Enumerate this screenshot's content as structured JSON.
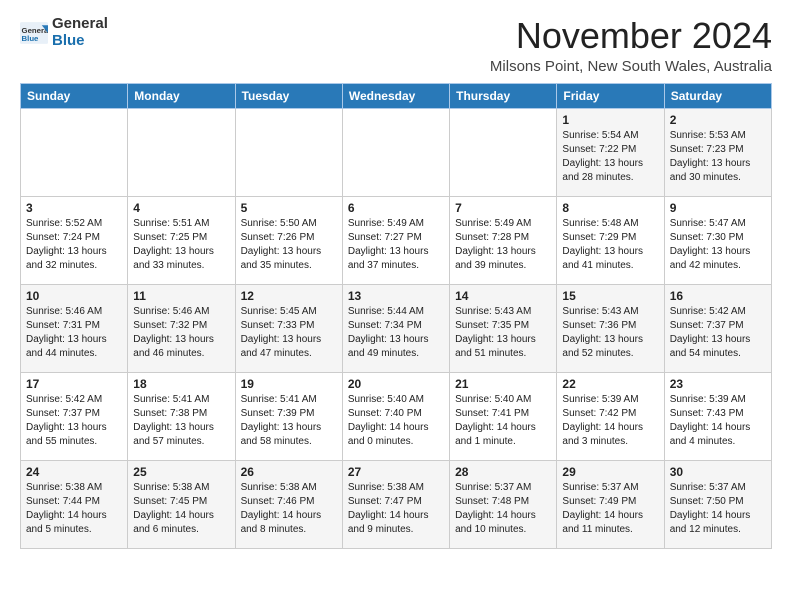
{
  "logo": {
    "text_general": "General",
    "text_blue": "Blue"
  },
  "title": "November 2024",
  "location": "Milsons Point, New South Wales, Australia",
  "days_of_week": [
    "Sunday",
    "Monday",
    "Tuesday",
    "Wednesday",
    "Thursday",
    "Friday",
    "Saturday"
  ],
  "weeks": [
    [
      {
        "day": "",
        "info": ""
      },
      {
        "day": "",
        "info": ""
      },
      {
        "day": "",
        "info": ""
      },
      {
        "day": "",
        "info": ""
      },
      {
        "day": "",
        "info": ""
      },
      {
        "day": "1",
        "info": "Sunrise: 5:54 AM\nSunset: 7:22 PM\nDaylight: 13 hours\nand 28 minutes."
      },
      {
        "day": "2",
        "info": "Sunrise: 5:53 AM\nSunset: 7:23 PM\nDaylight: 13 hours\nand 30 minutes."
      }
    ],
    [
      {
        "day": "3",
        "info": "Sunrise: 5:52 AM\nSunset: 7:24 PM\nDaylight: 13 hours\nand 32 minutes."
      },
      {
        "day": "4",
        "info": "Sunrise: 5:51 AM\nSunset: 7:25 PM\nDaylight: 13 hours\nand 33 minutes."
      },
      {
        "day": "5",
        "info": "Sunrise: 5:50 AM\nSunset: 7:26 PM\nDaylight: 13 hours\nand 35 minutes."
      },
      {
        "day": "6",
        "info": "Sunrise: 5:49 AM\nSunset: 7:27 PM\nDaylight: 13 hours\nand 37 minutes."
      },
      {
        "day": "7",
        "info": "Sunrise: 5:49 AM\nSunset: 7:28 PM\nDaylight: 13 hours\nand 39 minutes."
      },
      {
        "day": "8",
        "info": "Sunrise: 5:48 AM\nSunset: 7:29 PM\nDaylight: 13 hours\nand 41 minutes."
      },
      {
        "day": "9",
        "info": "Sunrise: 5:47 AM\nSunset: 7:30 PM\nDaylight: 13 hours\nand 42 minutes."
      }
    ],
    [
      {
        "day": "10",
        "info": "Sunrise: 5:46 AM\nSunset: 7:31 PM\nDaylight: 13 hours\nand 44 minutes."
      },
      {
        "day": "11",
        "info": "Sunrise: 5:46 AM\nSunset: 7:32 PM\nDaylight: 13 hours\nand 46 minutes."
      },
      {
        "day": "12",
        "info": "Sunrise: 5:45 AM\nSunset: 7:33 PM\nDaylight: 13 hours\nand 47 minutes."
      },
      {
        "day": "13",
        "info": "Sunrise: 5:44 AM\nSunset: 7:34 PM\nDaylight: 13 hours\nand 49 minutes."
      },
      {
        "day": "14",
        "info": "Sunrise: 5:43 AM\nSunset: 7:35 PM\nDaylight: 13 hours\nand 51 minutes."
      },
      {
        "day": "15",
        "info": "Sunrise: 5:43 AM\nSunset: 7:36 PM\nDaylight: 13 hours\nand 52 minutes."
      },
      {
        "day": "16",
        "info": "Sunrise: 5:42 AM\nSunset: 7:37 PM\nDaylight: 13 hours\nand 54 minutes."
      }
    ],
    [
      {
        "day": "17",
        "info": "Sunrise: 5:42 AM\nSunset: 7:37 PM\nDaylight: 13 hours\nand 55 minutes."
      },
      {
        "day": "18",
        "info": "Sunrise: 5:41 AM\nSunset: 7:38 PM\nDaylight: 13 hours\nand 57 minutes."
      },
      {
        "day": "19",
        "info": "Sunrise: 5:41 AM\nSunset: 7:39 PM\nDaylight: 13 hours\nand 58 minutes."
      },
      {
        "day": "20",
        "info": "Sunrise: 5:40 AM\nSunset: 7:40 PM\nDaylight: 14 hours\nand 0 minutes."
      },
      {
        "day": "21",
        "info": "Sunrise: 5:40 AM\nSunset: 7:41 PM\nDaylight: 14 hours\nand 1 minute."
      },
      {
        "day": "22",
        "info": "Sunrise: 5:39 AM\nSunset: 7:42 PM\nDaylight: 14 hours\nand 3 minutes."
      },
      {
        "day": "23",
        "info": "Sunrise: 5:39 AM\nSunset: 7:43 PM\nDaylight: 14 hours\nand 4 minutes."
      }
    ],
    [
      {
        "day": "24",
        "info": "Sunrise: 5:38 AM\nSunset: 7:44 PM\nDaylight: 14 hours\nand 5 minutes."
      },
      {
        "day": "25",
        "info": "Sunrise: 5:38 AM\nSunset: 7:45 PM\nDaylight: 14 hours\nand 6 minutes."
      },
      {
        "day": "26",
        "info": "Sunrise: 5:38 AM\nSunset: 7:46 PM\nDaylight: 14 hours\nand 8 minutes."
      },
      {
        "day": "27",
        "info": "Sunrise: 5:38 AM\nSunset: 7:47 PM\nDaylight: 14 hours\nand 9 minutes."
      },
      {
        "day": "28",
        "info": "Sunrise: 5:37 AM\nSunset: 7:48 PM\nDaylight: 14 hours\nand 10 minutes."
      },
      {
        "day": "29",
        "info": "Sunrise: 5:37 AM\nSunset: 7:49 PM\nDaylight: 14 hours\nand 11 minutes."
      },
      {
        "day": "30",
        "info": "Sunrise: 5:37 AM\nSunset: 7:50 PM\nDaylight: 14 hours\nand 12 minutes."
      }
    ]
  ]
}
